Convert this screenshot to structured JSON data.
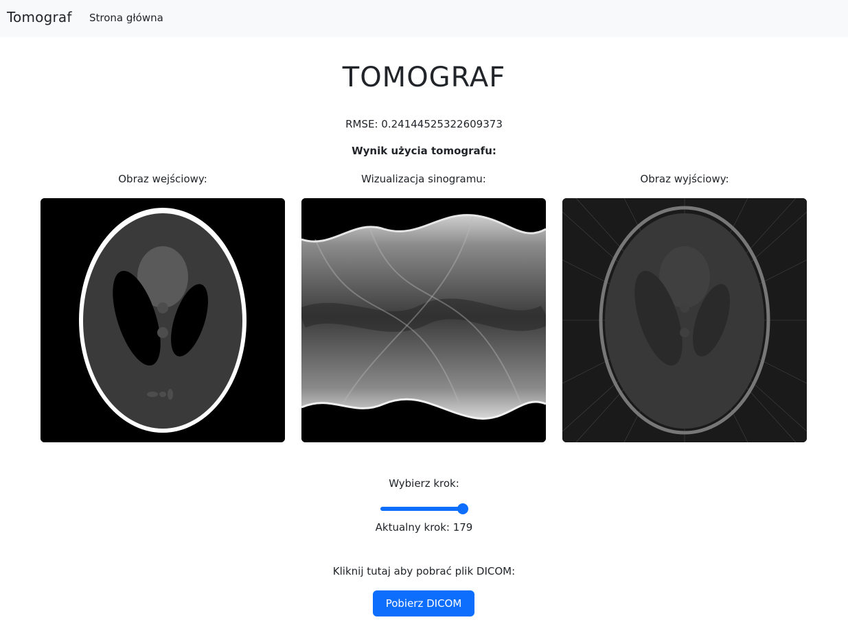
{
  "navbar": {
    "brand": "Tomograf",
    "links": [
      "Strona główna"
    ]
  },
  "main": {
    "title": "TOMOGRAF",
    "rmse": "RMSE: 0.24144525322609373",
    "result_heading": "Wynik użycia tomografu:",
    "columns": [
      {
        "label": "Obraz wejściowy:",
        "image": "shepp-logan-phantom"
      },
      {
        "label": "Wizualizacja sinogramu:",
        "image": "sinogram"
      },
      {
        "label": "Obraz wyjściowy:",
        "image": "reconstructed-phantom"
      }
    ],
    "step": {
      "label": "Wybierz krok:",
      "value_fraction": 1.0,
      "current_text": "Aktualny krok: 179"
    },
    "download": {
      "label": "Kliknij tutaj aby pobrać plik DICOM:",
      "button": "Pobierz DICOM"
    }
  },
  "colors": {
    "navbar_bg": "#f8f9fa",
    "primary": "#0d6efd",
    "text": "#212529"
  }
}
